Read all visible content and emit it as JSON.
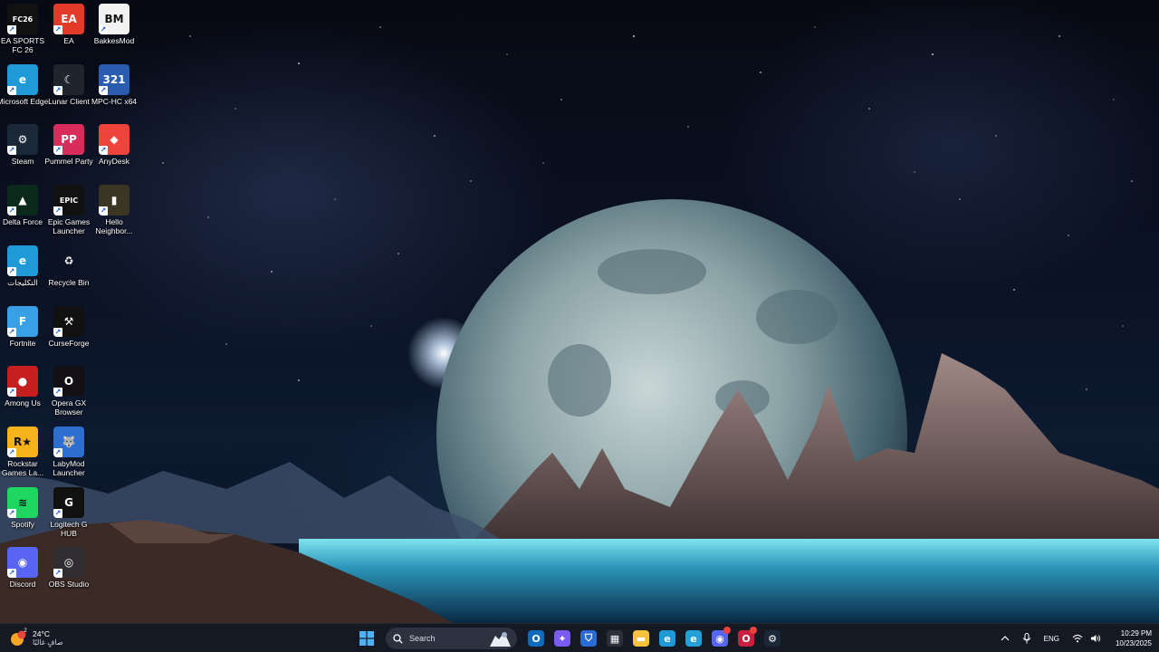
{
  "desktop": {
    "icons": [
      {
        "label": "EA SPORTS FC 26",
        "glyph": "FC26",
        "bg": "#111111",
        "icon": "ea-fc26-icon"
      },
      {
        "label": "EA",
        "glyph": "EA",
        "bg": "#e33b2a",
        "icon": "ea-app-icon"
      },
      {
        "label": "BakkesMod",
        "glyph": "BM",
        "bg": "#f2f2f2",
        "icon": "bakkesmod-icon"
      },
      {
        "label": "Microsoft Edge",
        "glyph": "e",
        "bg": "#1f9ad6",
        "icon": "edge-icon"
      },
      {
        "label": "Lunar Client",
        "glyph": "☾",
        "bg": "#20242c",
        "icon": "lunar-client-icon"
      },
      {
        "label": "MPC-HC x64",
        "glyph": "321",
        "bg": "#2a5db0",
        "icon": "mpc-hc-icon"
      },
      {
        "label": "Steam",
        "glyph": "⚙",
        "bg": "#1b2838",
        "icon": "steam-icon"
      },
      {
        "label": "Pummel Party",
        "glyph": "PP",
        "bg": "#d82c5b",
        "icon": "pummel-party-icon"
      },
      {
        "label": "AnyDesk",
        "glyph": "◆",
        "bg": "#ef443b",
        "icon": "anydesk-icon"
      },
      {
        "label": "Delta Force",
        "glyph": "▲",
        "bg": "#0c2a1c",
        "icon": "delta-force-icon"
      },
      {
        "label": "Epic Games Launcher",
        "glyph": "EPIC",
        "bg": "#111111",
        "icon": "epic-games-icon"
      },
      {
        "label": "Hello Neighbor...",
        "glyph": "▮",
        "bg": "#3b3524",
        "icon": "hello-neighbor-icon"
      },
      {
        "label": "التكليجات",
        "glyph": "e",
        "bg": "#1f9ad6",
        "icon": "edge-shortcut-icon"
      },
      {
        "label": "Recycle Bin",
        "glyph": "♻",
        "bg": "transparent",
        "icon": "recycle-bin-icon"
      },
      {
        "label": "Fortnite",
        "glyph": "F",
        "bg": "#3aa0e6",
        "icon": "fortnite-icon"
      },
      {
        "label": "CurseForge",
        "glyph": "⚒",
        "bg": "#111111",
        "icon": "curseforge-icon"
      },
      {
        "label": "Among Us",
        "glyph": "●",
        "bg": "#c71f1f",
        "icon": "among-us-icon"
      },
      {
        "label": "Opera GX Browser",
        "glyph": "O",
        "bg": "#121015",
        "icon": "opera-gx-icon"
      },
      {
        "label": "Rockstar Games La...",
        "glyph": "R★",
        "bg": "#f6b21a",
        "icon": "rockstar-launcher-icon"
      },
      {
        "label": "LabyMod Launcher",
        "glyph": "🐺",
        "bg": "#2d6fd0",
        "icon": "labymod-icon"
      },
      {
        "label": "Spotify",
        "glyph": "≋",
        "bg": "#1ed760",
        "icon": "spotify-icon"
      },
      {
        "label": "Logitech G HUB",
        "glyph": "G",
        "bg": "#111111",
        "icon": "logitech-ghub-icon"
      },
      {
        "label": "Discord",
        "glyph": "◉",
        "bg": "#5865f2",
        "icon": "discord-icon"
      },
      {
        "label": "OBS Studio",
        "glyph": "◎",
        "bg": "#302e31",
        "icon": "obs-studio-icon"
      }
    ]
  },
  "taskbar": {
    "weather": {
      "temp": "24°C",
      "condition": "صافٍ غالبًا",
      "badge": "2"
    },
    "search": {
      "placeholder": "Search"
    },
    "pinned": [
      {
        "icon": "outlook-icon",
        "color": "#0f6cbd",
        "glyph": "O"
      },
      {
        "icon": "copilot-icon",
        "color": "#7a5cf0",
        "glyph": "✦"
      },
      {
        "icon": "defender-icon",
        "color": "#2b6bd8",
        "glyph": "⛉"
      },
      {
        "icon": "microsoft-store-icon",
        "color": "#2c2f3a",
        "glyph": "▦"
      },
      {
        "icon": "file-explorer-icon",
        "color": "#f4c23d",
        "glyph": "▬"
      },
      {
        "icon": "edge-dev-icon",
        "color": "#1f9ad6",
        "glyph": "e"
      },
      {
        "icon": "edge-taskbar-icon",
        "color": "#22a0d8",
        "glyph": "e"
      },
      {
        "icon": "discord-taskbar-icon",
        "color": "#5865f2",
        "glyph": "◉"
      },
      {
        "icon": "opera-gx-taskbar-icon",
        "color": "#c8203e",
        "glyph": "O"
      },
      {
        "icon": "steam-taskbar-icon",
        "color": "#1b2838",
        "glyph": "⚙"
      }
    ],
    "tray": {
      "language": "ENG",
      "time": "10:29 PM",
      "date": "10/23/2025"
    }
  }
}
